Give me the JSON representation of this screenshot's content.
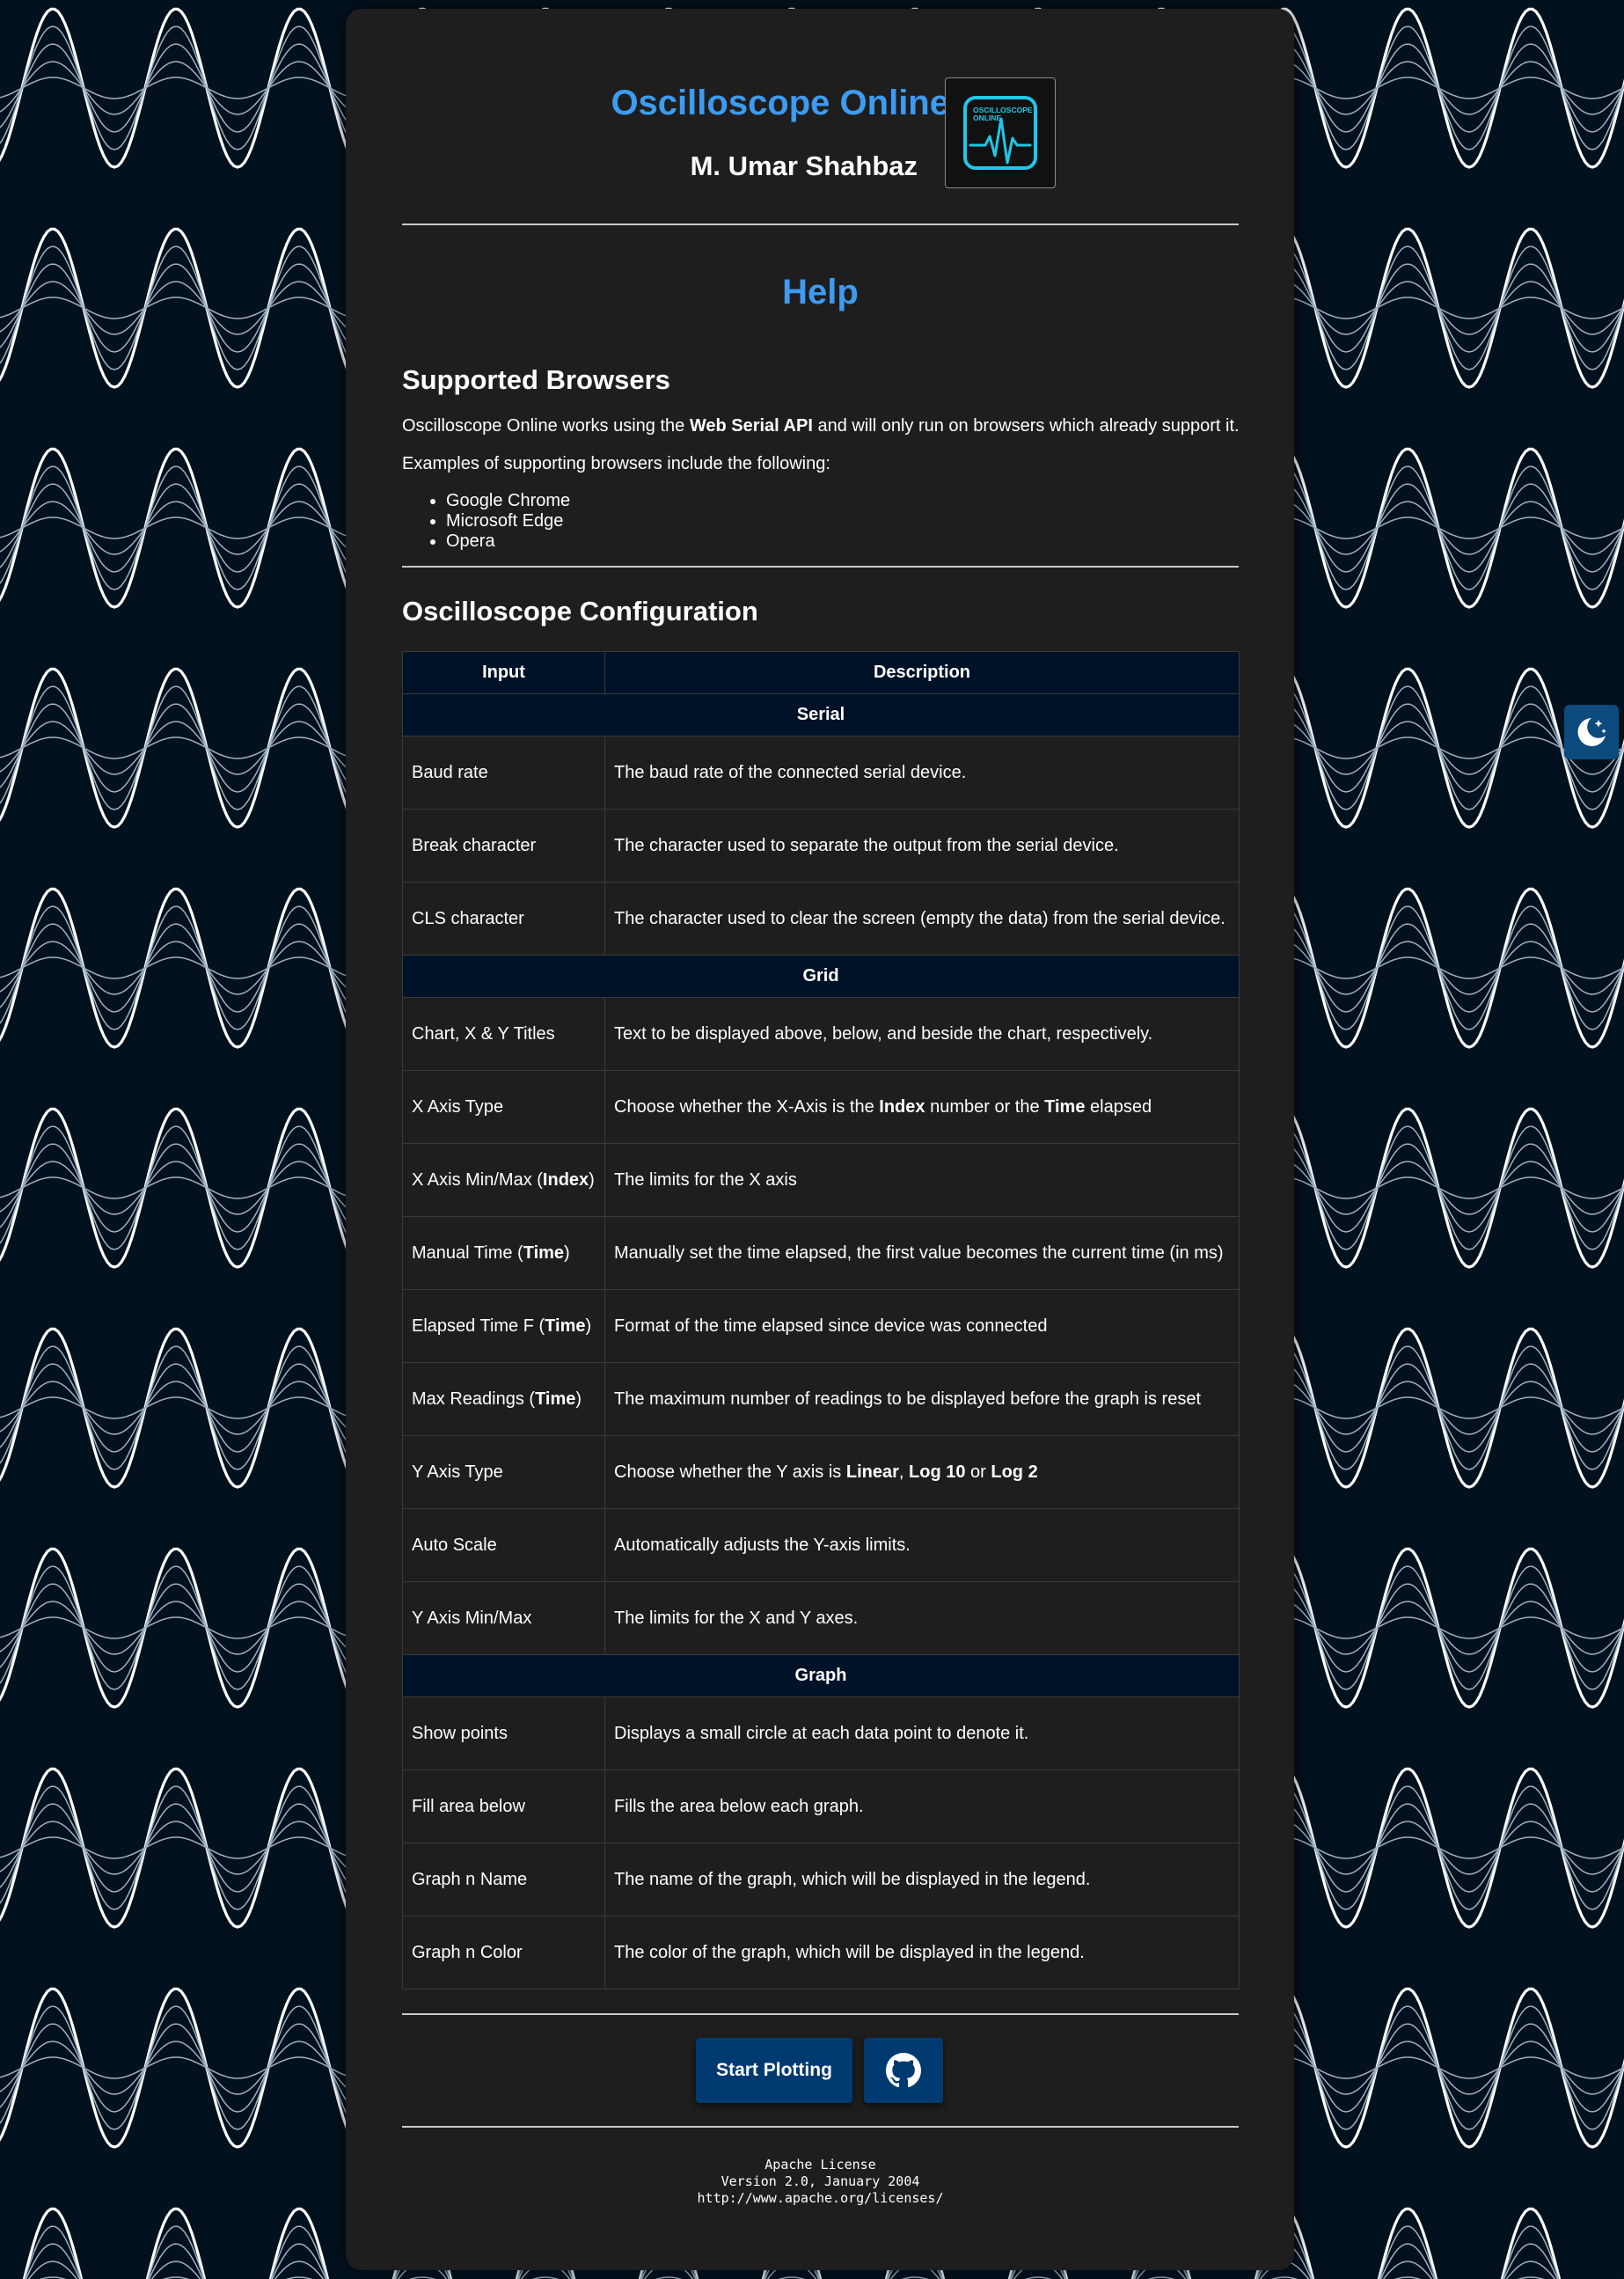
{
  "header": {
    "title": "Oscilloscope Online",
    "author": "M. Umar Shahbaz",
    "logo_text_line1": "OSCILLOSCOPE",
    "logo_text_line2": "ONLINE"
  },
  "help": {
    "title": "Help",
    "browsers": {
      "heading": "Supported Browsers",
      "intro_before": "Oscilloscope Online works using the ",
      "intro_bold": "Web Serial API",
      "intro_after": " and will only run on browsers which already support it.",
      "examples_text": "Examples of supporting browsers include the following:",
      "items": [
        "Google Chrome",
        "Microsoft Edge",
        "Opera"
      ]
    },
    "config": {
      "heading": "Oscilloscope Configuration",
      "col_input": "Input",
      "col_description": "Description",
      "sections": [
        {
          "title": "Serial",
          "rows": [
            {
              "input": "Baud rate",
              "description": "The baud rate of the connected serial device."
            },
            {
              "input": "Break character",
              "description": "The character used to separate the output from the serial device."
            },
            {
              "input": "CLS character",
              "description": "The character used to clear the screen (empty the data) from the serial device."
            }
          ]
        },
        {
          "title": "Grid",
          "rows": [
            {
              "input": "Chart, X & Y Titles",
              "description": "Text to be displayed above, below, and beside the chart, respectively."
            },
            {
              "input": "X Axis Type",
              "d1": "Choose whether the X-Axis is the ",
              "d2": "Index",
              "d3": " number or the ",
              "d4": "Time",
              "d5": " elapsed"
            },
            {
              "input": "X Axis Min/Max (",
              "input_bold": "Index",
              "input_end": ")",
              "description": "The limits for the X axis"
            },
            {
              "input": "Manual Time (",
              "input_bold": "Time",
              "input_end": ")",
              "description": "Manually set the time elapsed, the first value becomes the current time (in ms)"
            },
            {
              "input": "Elapsed Time F (",
              "input_bold": "Time",
              "input_end": ")",
              "description": "Format of the time elapsed since device was connected"
            },
            {
              "input": "Max Readings (",
              "input_bold": "Time",
              "input_end": ")",
              "description": "The maximum number of readings to be displayed before the graph is reset"
            },
            {
              "input": "Y Axis Type",
              "d1": "Choose whether the Y axis is ",
              "d2": "Linear",
              "d3": ", ",
              "d4": "Log 10",
              "d5": " or ",
              "d6": "Log 2"
            },
            {
              "input": "Auto Scale",
              "description": "Automatically adjusts the Y-axis limits."
            },
            {
              "input": "Y Axis Min/Max",
              "description": "The limits for the X and Y axes."
            }
          ]
        },
        {
          "title": "Graph",
          "rows": [
            {
              "input": "Show points",
              "description": "Displays a small circle at each data point to denote it."
            },
            {
              "input": "Fill area below",
              "description": "Fills the area below each graph."
            },
            {
              "input": "Graph n Name",
              "description": "The name of the graph, which will be displayed in the legend."
            },
            {
              "input": "Graph n Color",
              "description": "The color of the graph, which will be displayed in the legend."
            }
          ]
        }
      ]
    }
  },
  "actions": {
    "start_plotting_label": "Start Plotting",
    "github_icon": "github-icon"
  },
  "footer": {
    "license_lines": [
      "Apache License",
      "Version 2.0, January 2004",
      "http://www.apache.org/licenses/"
    ]
  },
  "theme_toggle": {
    "icon": "moon-stars-icon"
  },
  "colors": {
    "accent": "#3d9bf0",
    "background": "#03111f",
    "card": "#1e1e1e",
    "table_header": "#001228",
    "button": "#003a70",
    "toggle": "#0d4a7e"
  }
}
